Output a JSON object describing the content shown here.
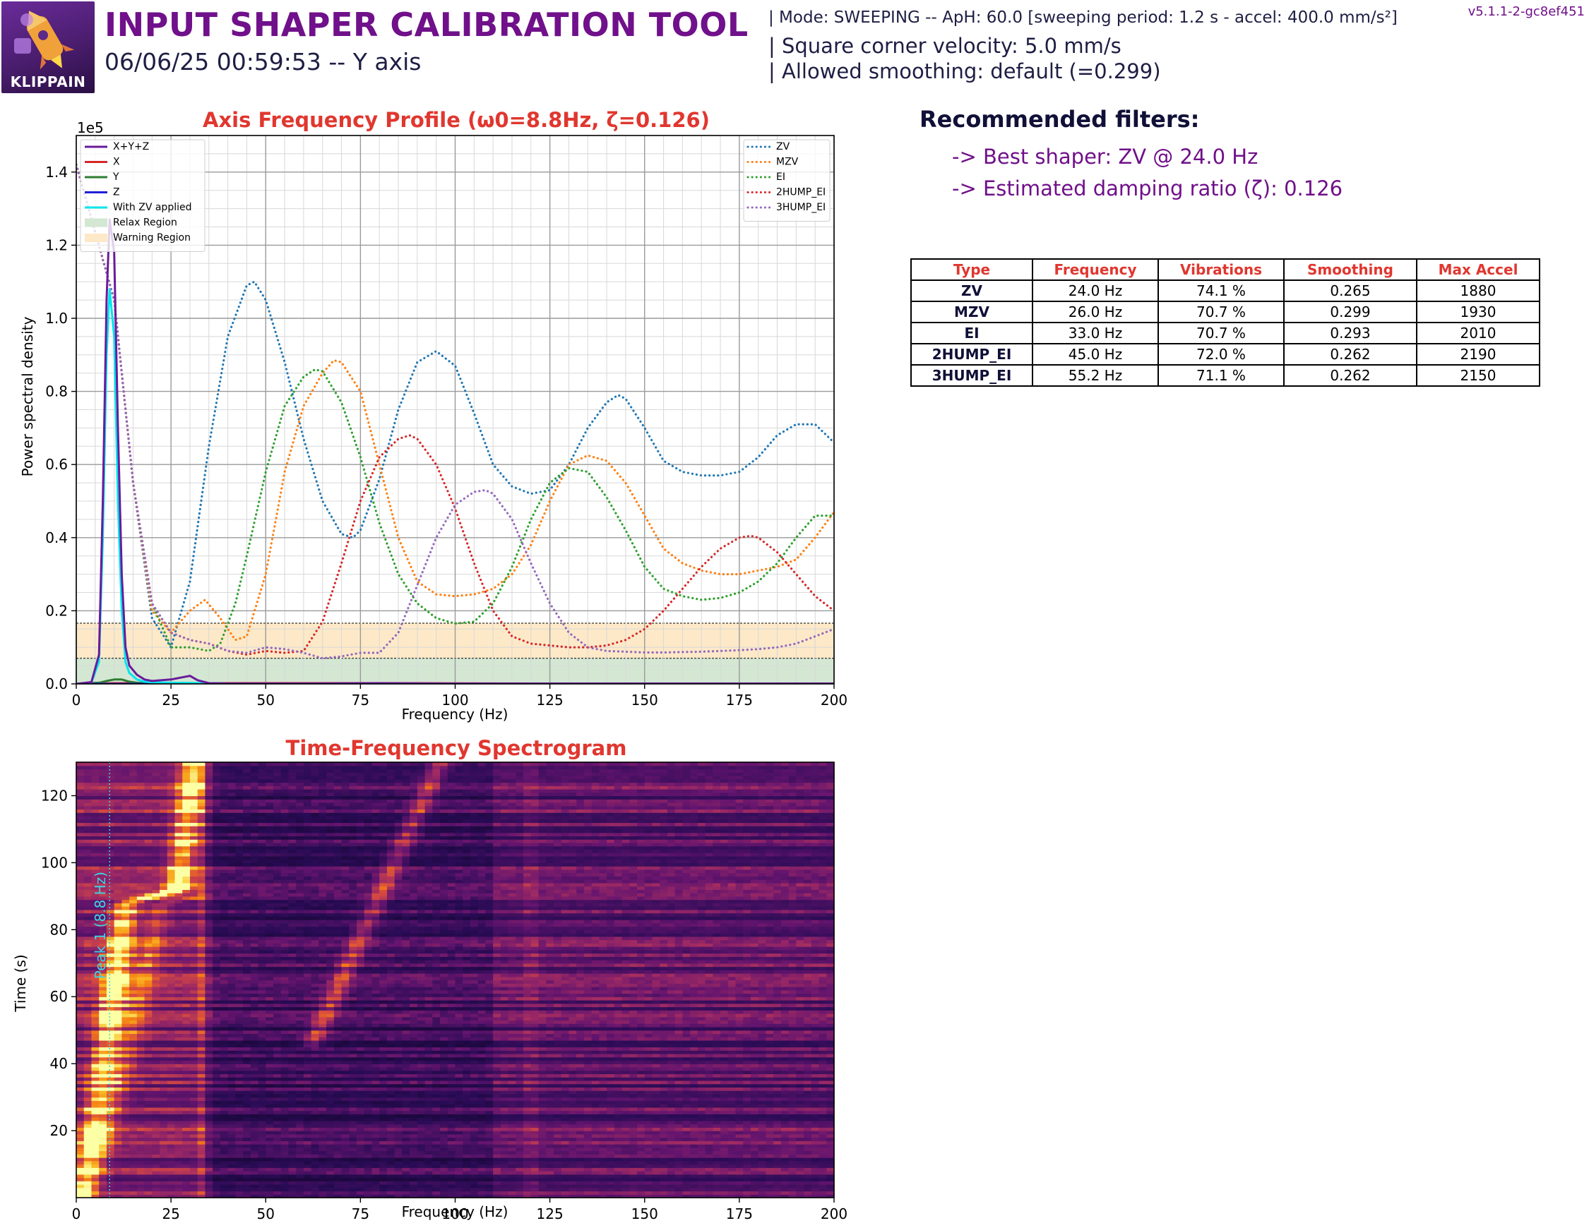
{
  "header": {
    "logo_text": "KLIPPAIN",
    "title": "INPUT SHAPER CALIBRATION TOOL",
    "subtitle": "06/06/25 00:59:53 -- Y axis",
    "config_line1": "| Mode: SWEEPING -- ApH: 60.0 [sweeping period: 1.2 s - accel: 400.0 mm/s²]",
    "config_line2": "| Square corner velocity: 5.0 mm/s",
    "config_line3": "| Allowed smoothing: default (=0.299)",
    "version": "v5.1.1-2-gc8ef451"
  },
  "recommendations": {
    "title": "Recommended filters:",
    "line1": "-> Best shaper: ZV @ 24.0 Hz",
    "line2": "-> Estimated damping ratio (ζ): 0.126"
  },
  "table": {
    "headers": [
      "Type",
      "Frequency",
      "Vibrations",
      "Smoothing",
      "Max Accel"
    ],
    "rows": [
      [
        "ZV",
        "24.0 Hz",
        "74.1 %",
        "0.265",
        "1880"
      ],
      [
        "MZV",
        "26.0 Hz",
        "70.7 %",
        "0.299",
        "1930"
      ],
      [
        "EI",
        "33.0 Hz",
        "70.7 %",
        "0.293",
        "2010"
      ],
      [
        "2HUMP_EI",
        "45.0 Hz",
        "72.0 %",
        "0.262",
        "2190"
      ],
      [
        "3HUMP_EI",
        "55.2 Hz",
        "71.1 %",
        "0.262",
        "2150"
      ]
    ]
  },
  "chart_data": [
    {
      "type": "line",
      "title": "Axis Frequency Profile (ω0=8.8Hz, ζ=0.126)",
      "xlabel": "Frequency (Hz)",
      "ylabel": "Power spectral density",
      "y_scale_label": "1e5",
      "xlim": [
        0,
        200
      ],
      "ylim": [
        0,
        1.5
      ],
      "x_ticks": [
        0,
        25,
        50,
        75,
        100,
        125,
        150,
        175,
        200
      ],
      "y_ticks": [
        0.0,
        0.2,
        0.4,
        0.6,
        0.8,
        1.0,
        1.2,
        1.4
      ],
      "grid": true,
      "legend_left_position": "top-left",
      "legend_right_position": "top-right",
      "regions": [
        {
          "name": "Relax Region",
          "from": 0,
          "to": 0.07,
          "color": "#d3e7d3"
        },
        {
          "name": "Warning Region",
          "from": 0.07,
          "to": 0.166,
          "color": "#fde9c8"
        }
      ],
      "series": [
        {
          "name": "X+Y+Z",
          "color": "#6a1b9a",
          "style": "solid",
          "x": [
            0,
            4,
            6,
            7,
            8,
            8.8,
            10,
            11,
            12,
            13,
            14,
            16,
            18,
            20,
            25,
            28,
            30,
            32,
            35,
            40,
            60,
            80,
            100,
            150,
            200
          ],
          "y": [
            0,
            0.005,
            0.08,
            0.5,
            1.05,
            1.27,
            1.18,
            0.7,
            0.3,
            0.1,
            0.05,
            0.025,
            0.012,
            0.008,
            0.012,
            0.018,
            0.022,
            0.01,
            0.002,
            0.001,
            0.001,
            0.002,
            0.001,
            0.001,
            0.001
          ]
        },
        {
          "name": "X",
          "color": "#d62728",
          "style": "solid",
          "x": [
            0,
            10,
            30,
            80,
            120,
            200
          ],
          "y": [
            0,
            0.002,
            0.002,
            0.002,
            0.001,
            0.001
          ]
        },
        {
          "name": "Y",
          "color": "#2e7d32",
          "style": "solid",
          "x": [
            0,
            6,
            8,
            10,
            12,
            14,
            16,
            20,
            200
          ],
          "y": [
            0,
            0.003,
            0.008,
            0.012,
            0.012,
            0.006,
            0.003,
            0.001,
            0.0005
          ]
        },
        {
          "name": "Z",
          "color": "#1f1fd6",
          "style": "solid",
          "x": [
            0,
            50,
            100,
            200
          ],
          "y": [
            0,
            0.0005,
            0.0003,
            0.0002
          ]
        },
        {
          "name": "With ZV applied",
          "color": "#00e5ee",
          "style": "solid",
          "x": [
            0,
            4,
            6,
            7,
            8,
            8.8,
            10,
            11,
            12,
            13,
            14,
            16,
            18,
            20,
            25,
            40,
            200
          ],
          "y": [
            0,
            0.004,
            0.06,
            0.4,
            0.9,
            1.08,
            0.95,
            0.5,
            0.2,
            0.06,
            0.03,
            0.012,
            0.006,
            0.004,
            0.003,
            0.001,
            0.0005
          ]
        },
        {
          "name": "ZV",
          "color": "#1f77b4",
          "style": "dotted",
          "x": [
            0,
            10,
            15,
            20,
            25,
            30,
            35,
            40,
            45,
            47,
            50,
            55,
            60,
            65,
            70,
            73,
            75,
            80,
            85,
            90,
            95,
            100,
            105,
            110,
            115,
            120,
            125,
            130,
            135,
            140,
            143,
            145,
            150,
            155,
            160,
            165,
            170,
            175,
            180,
            185,
            190,
            195,
            200
          ],
          "y": [
            1.42,
            1.05,
            0.55,
            0.18,
            0.1,
            0.28,
            0.65,
            0.95,
            1.09,
            1.1,
            1.05,
            0.88,
            0.67,
            0.5,
            0.41,
            0.4,
            0.42,
            0.56,
            0.75,
            0.88,
            0.91,
            0.87,
            0.74,
            0.6,
            0.54,
            0.52,
            0.53,
            0.6,
            0.7,
            0.77,
            0.79,
            0.78,
            0.7,
            0.61,
            0.58,
            0.57,
            0.57,
            0.58,
            0.62,
            0.68,
            0.71,
            0.71,
            0.66
          ]
        },
        {
          "name": "MZV",
          "color": "#ff7f0e",
          "style": "dotted",
          "x": [
            0,
            10,
            15,
            20,
            25,
            30,
            34,
            38,
            42,
            45,
            50,
            55,
            60,
            65,
            68,
            70,
            75,
            80,
            85,
            90,
            95,
            100,
            105,
            110,
            115,
            120,
            125,
            130,
            135,
            140,
            145,
            150,
            155,
            160,
            165,
            170,
            175,
            180,
            185,
            190,
            195,
            200
          ],
          "y": [
            1.42,
            1.05,
            0.55,
            0.2,
            0.14,
            0.2,
            0.23,
            0.18,
            0.12,
            0.13,
            0.3,
            0.58,
            0.76,
            0.85,
            0.885,
            0.88,
            0.8,
            0.6,
            0.4,
            0.28,
            0.245,
            0.24,
            0.245,
            0.26,
            0.3,
            0.38,
            0.5,
            0.6,
            0.625,
            0.61,
            0.55,
            0.46,
            0.37,
            0.33,
            0.31,
            0.3,
            0.3,
            0.31,
            0.32,
            0.34,
            0.4,
            0.47
          ]
        },
        {
          "name": "EI",
          "color": "#2ca02c",
          "style": "dotted",
          "x": [
            0,
            10,
            15,
            20,
            25,
            30,
            35,
            38,
            42,
            45,
            50,
            55,
            60,
            63,
            65,
            70,
            75,
            80,
            85,
            90,
            95,
            100,
            105,
            110,
            115,
            120,
            125,
            130,
            135,
            140,
            145,
            150,
            155,
            160,
            165,
            170,
            175,
            180,
            185,
            190,
            195,
            200
          ],
          "y": [
            1.42,
            1.05,
            0.55,
            0.22,
            0.1,
            0.1,
            0.09,
            0.11,
            0.22,
            0.35,
            0.58,
            0.76,
            0.84,
            0.86,
            0.855,
            0.77,
            0.62,
            0.44,
            0.3,
            0.22,
            0.18,
            0.165,
            0.17,
            0.22,
            0.32,
            0.45,
            0.55,
            0.59,
            0.58,
            0.51,
            0.42,
            0.32,
            0.26,
            0.24,
            0.23,
            0.235,
            0.25,
            0.28,
            0.33,
            0.4,
            0.46,
            0.46
          ]
        },
        {
          "name": "2HUMP_EI",
          "color": "#d62728",
          "style": "dotted",
          "x": [
            0,
            10,
            15,
            20,
            25,
            30,
            35,
            40,
            45,
            50,
            55,
            60,
            65,
            70,
            75,
            80,
            85,
            88,
            90,
            95,
            100,
            105,
            110,
            115,
            120,
            125,
            130,
            135,
            140,
            145,
            150,
            155,
            160,
            165,
            170,
            175,
            178,
            180,
            185,
            190,
            195,
            200
          ],
          "y": [
            1.42,
            1.05,
            0.55,
            0.22,
            0.14,
            0.12,
            0.11,
            0.09,
            0.08,
            0.09,
            0.085,
            0.09,
            0.17,
            0.33,
            0.5,
            0.62,
            0.67,
            0.68,
            0.67,
            0.6,
            0.48,
            0.33,
            0.2,
            0.13,
            0.11,
            0.105,
            0.1,
            0.1,
            0.105,
            0.12,
            0.15,
            0.2,
            0.26,
            0.32,
            0.37,
            0.4,
            0.405,
            0.4,
            0.36,
            0.3,
            0.24,
            0.2
          ]
        },
        {
          "name": "3HUMP_EI",
          "color": "#9467bd",
          "style": "dotted",
          "x": [
            0,
            10,
            15,
            20,
            25,
            30,
            35,
            40,
            45,
            50,
            55,
            60,
            65,
            70,
            75,
            80,
            85,
            90,
            95,
            100,
            105,
            108,
            110,
            115,
            120,
            125,
            130,
            135,
            140,
            145,
            150,
            155,
            160,
            165,
            170,
            175,
            180,
            185,
            190,
            195,
            200
          ],
          "y": [
            1.42,
            1.05,
            0.55,
            0.22,
            0.14,
            0.12,
            0.11,
            0.09,
            0.085,
            0.1,
            0.095,
            0.085,
            0.07,
            0.075,
            0.085,
            0.085,
            0.14,
            0.27,
            0.4,
            0.49,
            0.525,
            0.53,
            0.52,
            0.45,
            0.33,
            0.22,
            0.14,
            0.1,
            0.09,
            0.088,
            0.086,
            0.086,
            0.087,
            0.088,
            0.09,
            0.092,
            0.095,
            0.1,
            0.11,
            0.13,
            0.15
          ]
        }
      ]
    },
    {
      "type": "heatmap",
      "title": "Time-Frequency Spectrogram",
      "xlabel": "Frequency (Hz)",
      "ylabel": "Time (s)",
      "xlim": [
        0,
        200
      ],
      "ylim": [
        0,
        130
      ],
      "x_ticks": [
        0,
        25,
        50,
        75,
        100,
        125,
        150,
        175,
        200
      ],
      "y_ticks": [
        20,
        40,
        60,
        80,
        100,
        120
      ],
      "colormap": "inferno",
      "peak_marker": {
        "label": "Peak 1 (8.8 Hz)",
        "x": 8.8,
        "color": "#3ad6e6"
      }
    }
  ]
}
